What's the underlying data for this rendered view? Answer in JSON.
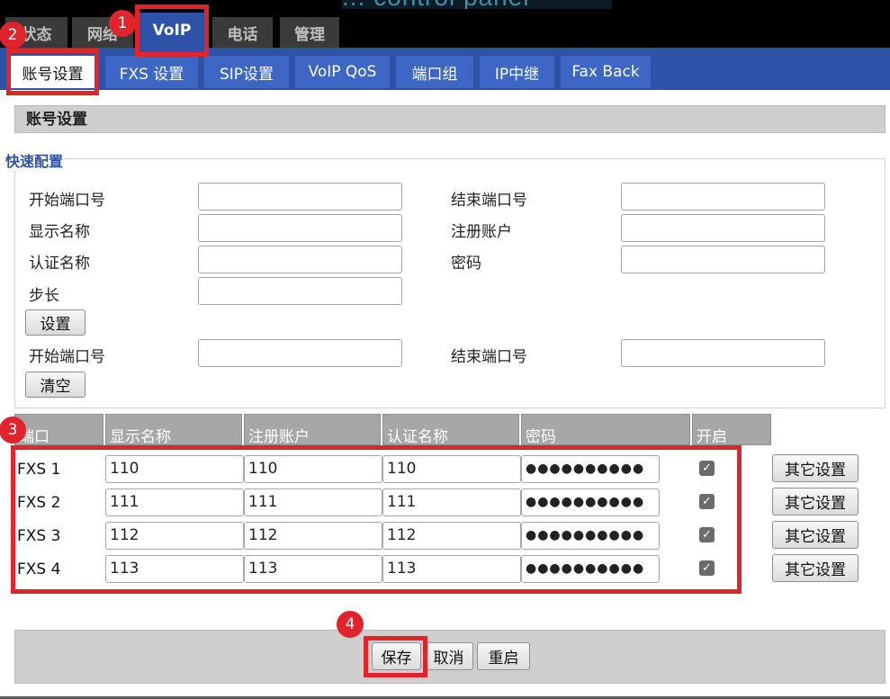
{
  "header": {
    "logo_text": "... control panel",
    "top_tabs": [
      {
        "label": "状态"
      },
      {
        "label": "网络"
      },
      {
        "label": "VoIP"
      },
      {
        "label": "电话"
      },
      {
        "label": "管理"
      }
    ],
    "sub_tabs": [
      {
        "label": "账号设置"
      },
      {
        "label": "FXS 设置"
      },
      {
        "label": "SIP设置"
      },
      {
        "label": "VoIP QoS"
      },
      {
        "label": "端口组"
      },
      {
        "label": "IP中继"
      },
      {
        "label": "Fax Back"
      }
    ]
  },
  "section": {
    "title": "账号设置"
  },
  "quick_config": {
    "title": "快速配置",
    "start_port_label": "开始端口号",
    "end_port_label": "结束端口号",
    "display_name_label": "显示名称",
    "register_account_label": "注册账户",
    "auth_name_label": "认证名称",
    "password_label": "密码",
    "step_label": "步长",
    "set_button": "设置",
    "clear_start_port_label": "开始端口号",
    "clear_end_port_label": "结束端口号",
    "clear_button": "清空"
  },
  "table": {
    "headers": [
      "端口",
      "显示名称",
      "注册账户",
      "认证名称",
      "密码",
      "开启"
    ],
    "rows": [
      {
        "port": "FXS 1",
        "display_name": "110",
        "register_account": "110",
        "auth_name": "110",
        "password": "●●●●●●●●●●",
        "enabled": true,
        "other_button": "其它设置"
      },
      {
        "port": "FXS 2",
        "display_name": "111",
        "register_account": "111",
        "auth_name": "111",
        "password": "●●●●●●●●●●",
        "enabled": true,
        "other_button": "其它设置"
      },
      {
        "port": "FXS 3",
        "display_name": "112",
        "register_account": "112",
        "auth_name": "112",
        "password": "●●●●●●●●●●",
        "enabled": true,
        "other_button": "其它设置"
      },
      {
        "port": "FXS 4",
        "display_name": "113",
        "register_account": "113",
        "auth_name": "113",
        "password": "●●●●●●●●●●",
        "enabled": true,
        "other_button": "其它设置"
      }
    ]
  },
  "footer": {
    "save_button": "保存",
    "cancel_button": "取消",
    "restart_button": "重启"
  },
  "annotations": {
    "badges": [
      "1",
      "2",
      "3",
      "4"
    ],
    "highlight_color": "#e0242c"
  },
  "colors": {
    "primary_blue": "#2d52a8",
    "tab_blue": "#3e66c4",
    "header_gray": "#a7a7a7"
  }
}
